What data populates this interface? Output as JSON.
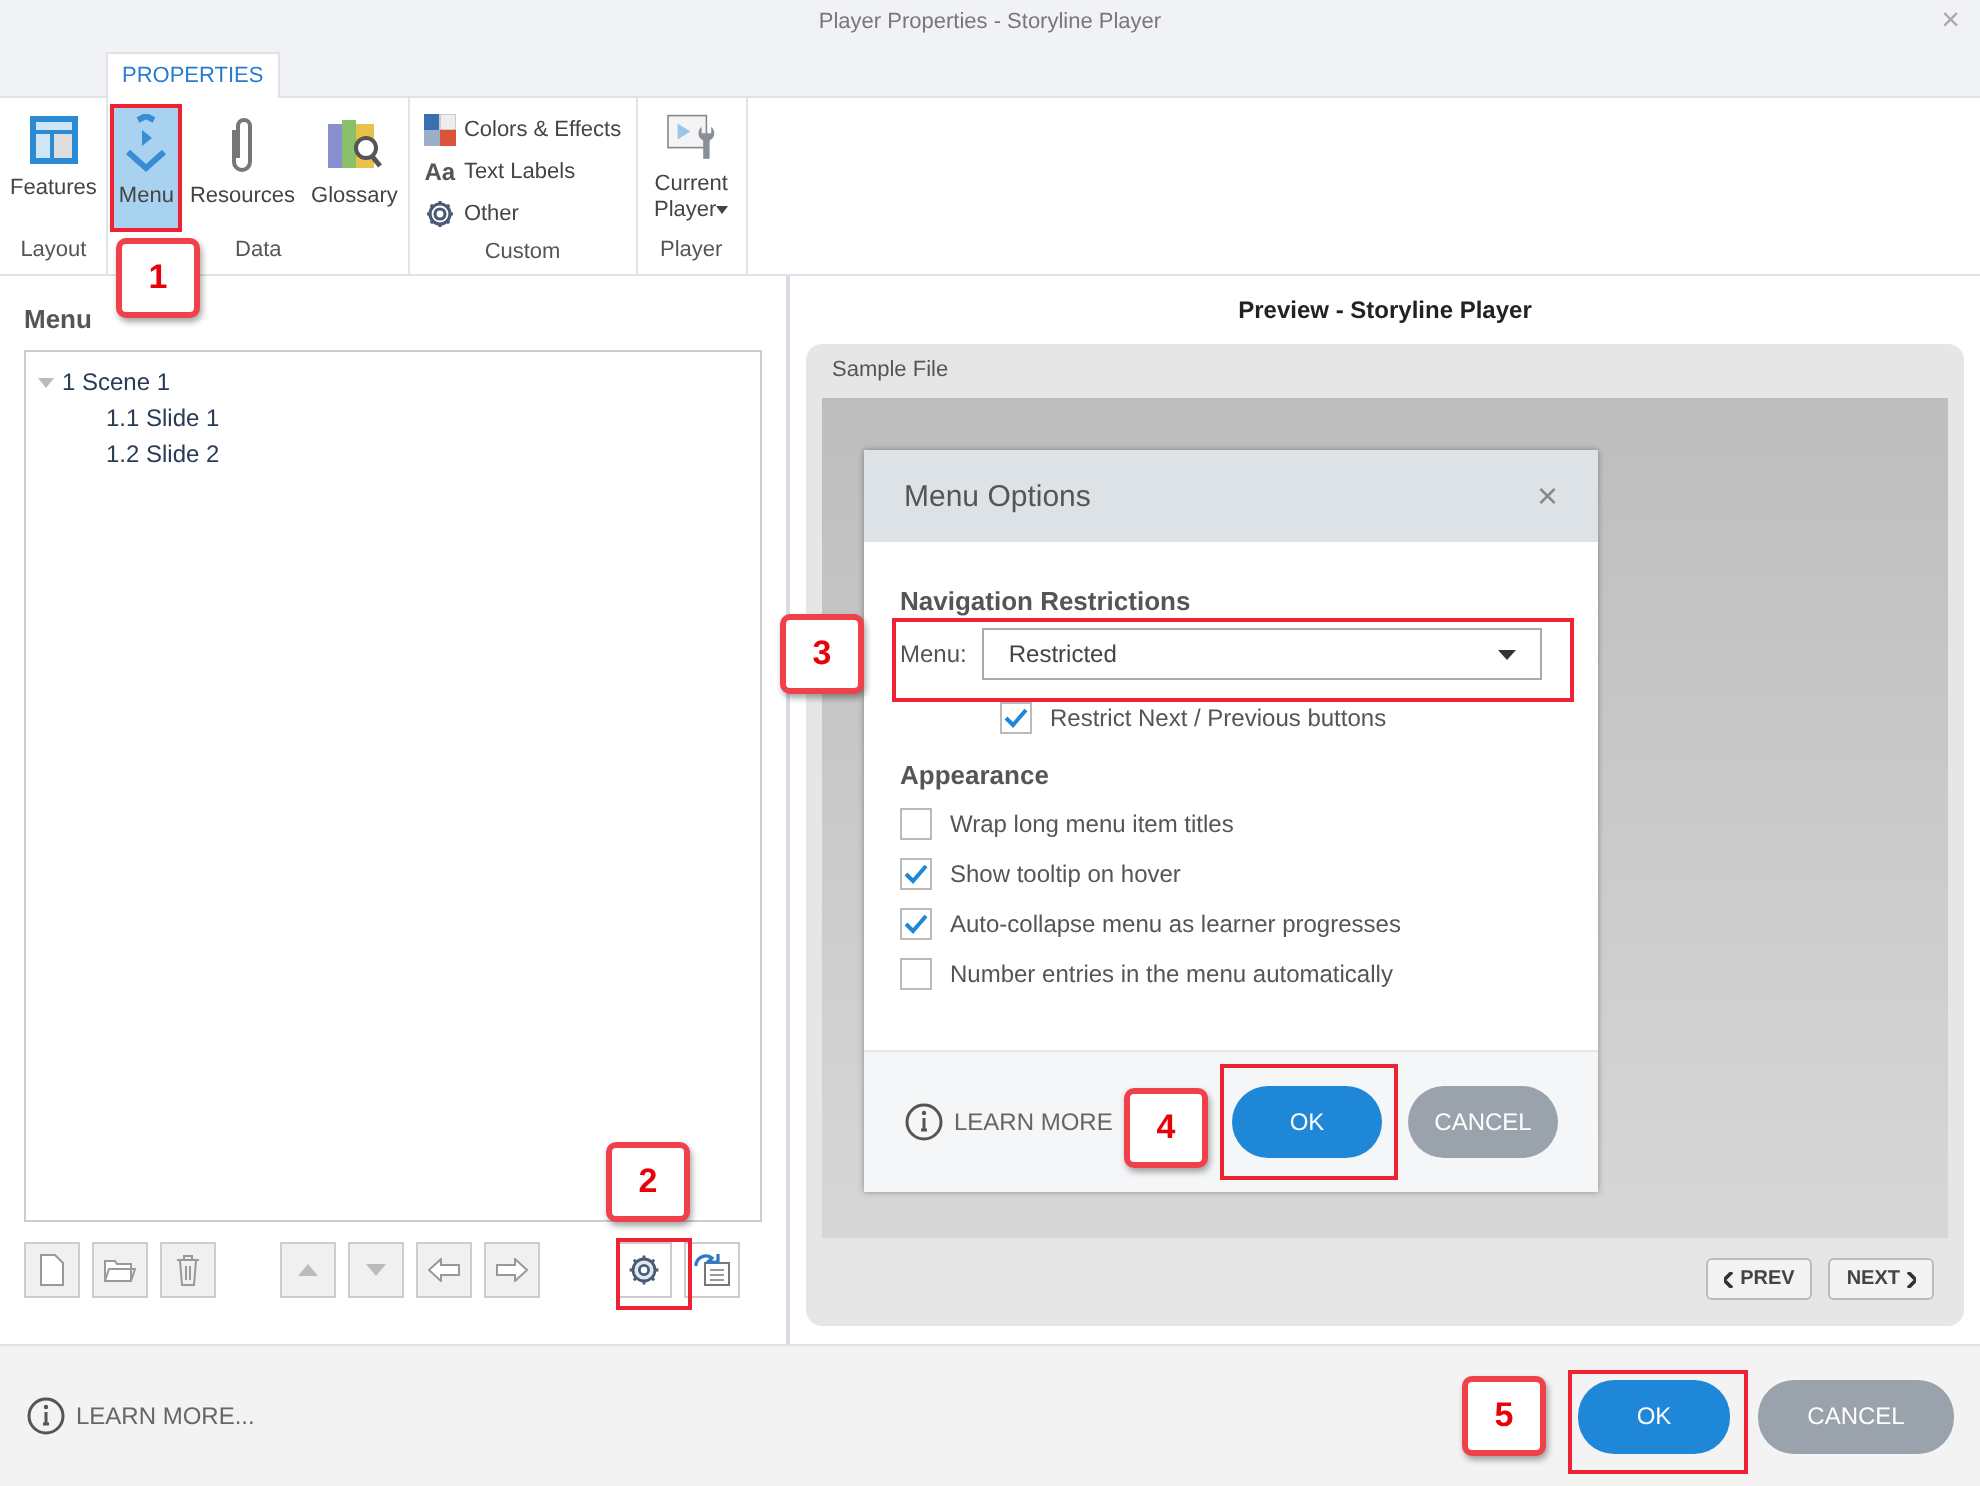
{
  "window": {
    "title": "Player Properties - Storyline Player",
    "close": "×"
  },
  "tabs": [
    {
      "label": "PROPERTIES",
      "selected": true
    }
  ],
  "ribbon_groups": [
    {
      "label": "Layout",
      "items": [
        {
          "kind": "large",
          "label": "Features",
          "selected": false
        }
      ]
    },
    {
      "label": "Data",
      "items": [
        {
          "kind": "large",
          "label": "Menu",
          "selected": true
        },
        {
          "kind": "large",
          "label": "Resources",
          "selected": false
        },
        {
          "kind": "large",
          "label": "Glossary",
          "selected": false
        }
      ]
    },
    {
      "label": "Custom",
      "items": [
        {
          "kind": "small",
          "label": "Colors & Effects"
        },
        {
          "kind": "small",
          "icon_text": "Aa",
          "label": "Text Labels"
        },
        {
          "kind": "small",
          "label": "Other"
        }
      ]
    },
    {
      "label": "Player",
      "items": [
        {
          "kind": "dropdown",
          "label": "Current Player",
          "selected": false
        }
      ]
    }
  ],
  "menu_panel": {
    "title": "Menu",
    "tree": [
      {
        "label": "1 Scene 1",
        "expanded": true,
        "children": [
          {
            "label": "1.1 Slide 1"
          },
          {
            "label": "1.2 Slide 2"
          }
        ]
      }
    ],
    "toolbar": [
      {
        "kind": "new"
      },
      {
        "kind": "folder"
      },
      {
        "kind": "trash"
      },
      {
        "kind": "gap"
      },
      {
        "kind": "up"
      },
      {
        "kind": "down"
      },
      {
        "kind": "left"
      },
      {
        "kind": "right"
      },
      {
        "kind": "gap"
      },
      {
        "kind": "gear"
      },
      {
        "kind": "import"
      }
    ]
  },
  "preview": {
    "title": "Preview - Storyline Player",
    "player_title": "Sample File",
    "dialog": {
      "title": "Menu Options",
      "close": "×",
      "section": "Navigation Restrictions",
      "menu_label": "Menu:",
      "menu_value": "Restricted",
      "restrict": {
        "label": "Restrict Next / Previous buttons",
        "checked": true
      },
      "appearance": "Appearance",
      "options": [
        {
          "label": "Wrap long menu item titles",
          "checked": false
        },
        {
          "label": "Show tooltip on hover",
          "checked": true
        },
        {
          "label": "Auto-collapse menu as learner progresses",
          "checked": true
        },
        {
          "label": "Number entries in the menu automatically",
          "checked": false
        }
      ],
      "learn_more": "LEARN MORE",
      "ok": "OK",
      "cancel": "CANCEL"
    },
    "prev": "PREV",
    "next": "NEXT"
  },
  "footer": {
    "learn_more": "LEARN MORE...",
    "ok": "OK",
    "cancel": "CANCEL"
  },
  "callouts": [
    {
      "label": "1"
    },
    {
      "label": "2"
    },
    {
      "label": "3"
    },
    {
      "label": "4"
    },
    {
      "label": "5"
    }
  ]
}
